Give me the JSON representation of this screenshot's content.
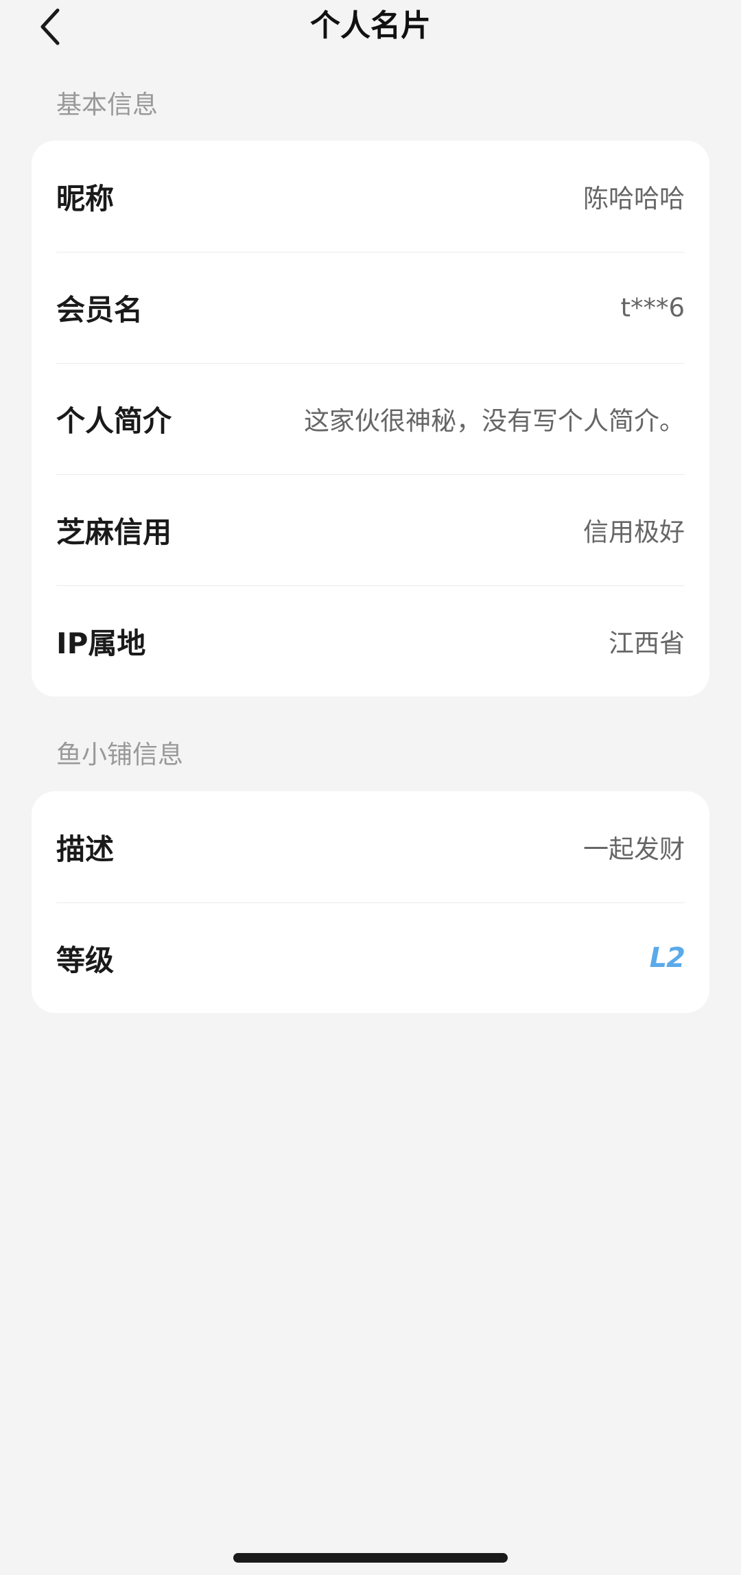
{
  "header": {
    "title": "个人名片",
    "back_icon": "chevron-left-icon"
  },
  "basic_info": {
    "section_title": "基本信息",
    "rows": [
      {
        "label": "昵称",
        "value": "陈哈哈哈"
      },
      {
        "label": "会员名",
        "value": "t***6"
      },
      {
        "label": "个人简介",
        "value": "这家伙很神秘，没有写个人简介。"
      },
      {
        "label": "芝麻信用",
        "value": "信用极好"
      },
      {
        "label": "IP属地",
        "value": "江西省"
      }
    ]
  },
  "shop_info": {
    "section_title": "鱼小铺信息",
    "rows": [
      {
        "label": "描述",
        "value": "一起发财"
      },
      {
        "label": "等级",
        "value": "L2"
      }
    ]
  },
  "colors": {
    "background": "#f4f4f4",
    "card": "#ffffff",
    "level_badge": "#5aaaea",
    "section_title": "#999999",
    "value_text": "#666666"
  }
}
